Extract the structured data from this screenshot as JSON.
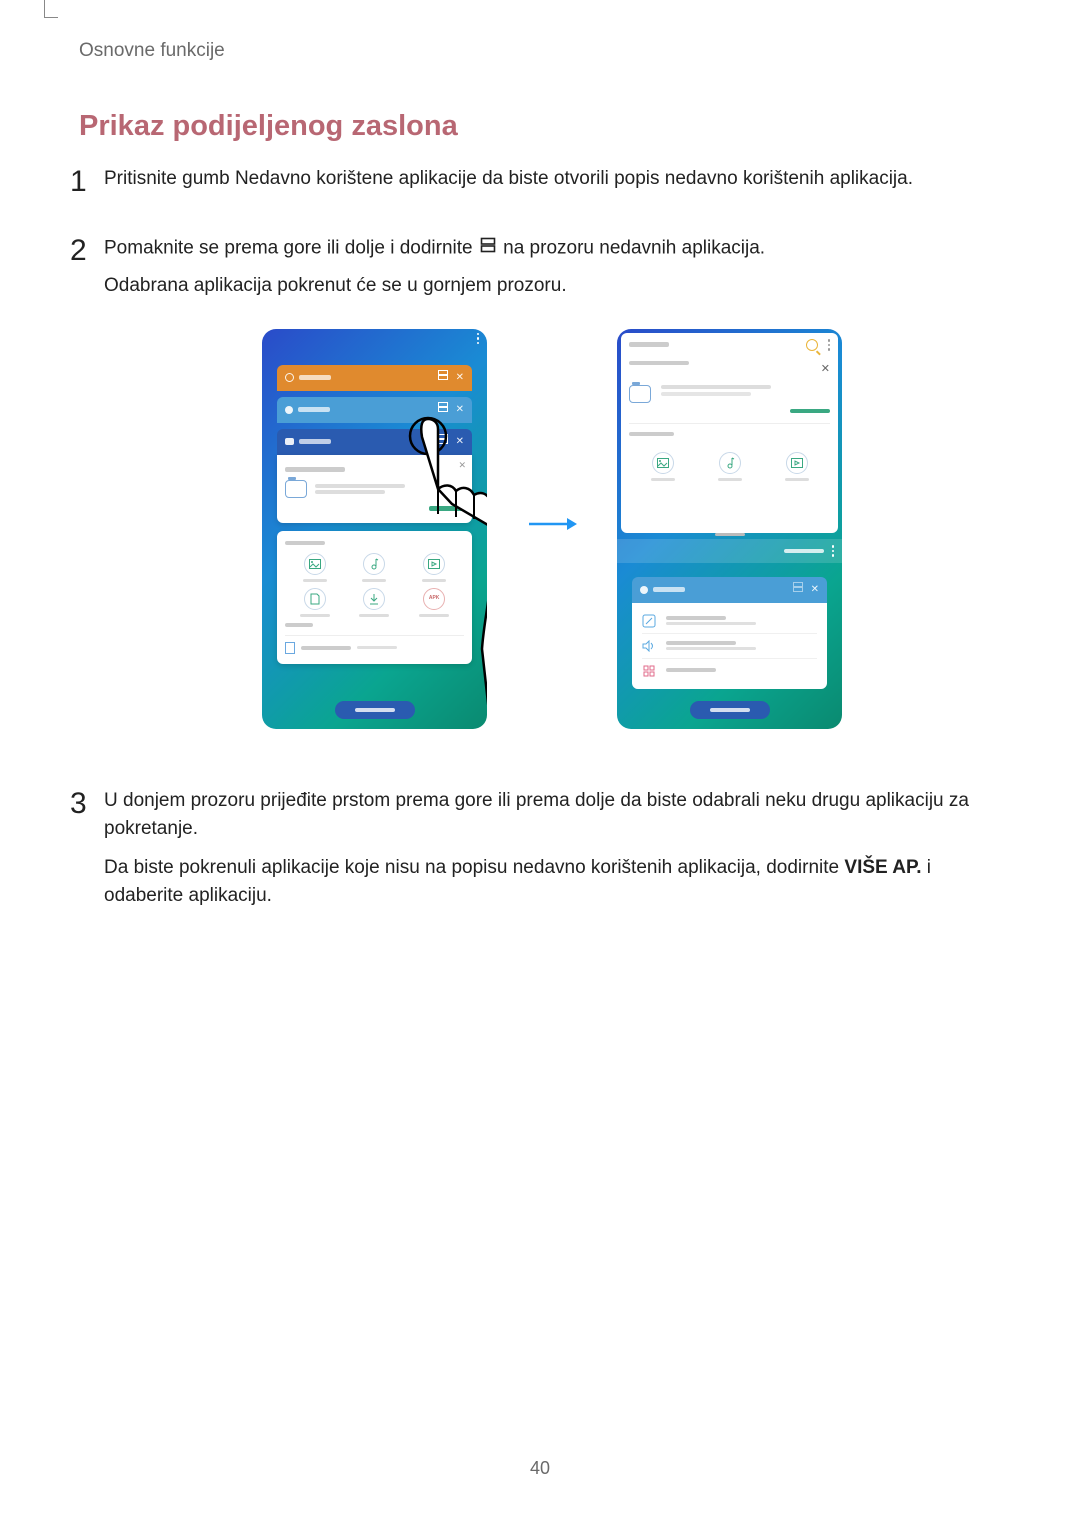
{
  "breadcrumb": "Osnovne funkcije",
  "section_title": "Prikaz podijeljenog zaslona",
  "steps": [
    {
      "num": "1",
      "paras": [
        "Pritisnite gumb Nedavno korištene aplikacije da biste otvorili popis nedavno korištenih aplikacija."
      ]
    },
    {
      "num": "2",
      "paras": [
        "Pomaknite se prema gore ili dolje i dodirnite {ICON} na prozoru nedavnih aplikacija.",
        "Odabrana aplikacija pokrenut će se u gornjem prozoru."
      ]
    },
    {
      "num": "3",
      "paras": [
        "U donjem prozoru prijeđite prstom prema gore ili prema dolje da biste odabrali neku drugu aplikaciju za pokretanje.",
        "Da biste pokrenuli aplikacije koje nisu na popisu nedavno korištenih aplikacija, dodirnite {BOLD:VIŠE AP.} i odaberite aplikaciju."
      ]
    }
  ],
  "page_number": "40",
  "figure": {
    "left_phone": {
      "apk_label": "APK"
    }
  }
}
